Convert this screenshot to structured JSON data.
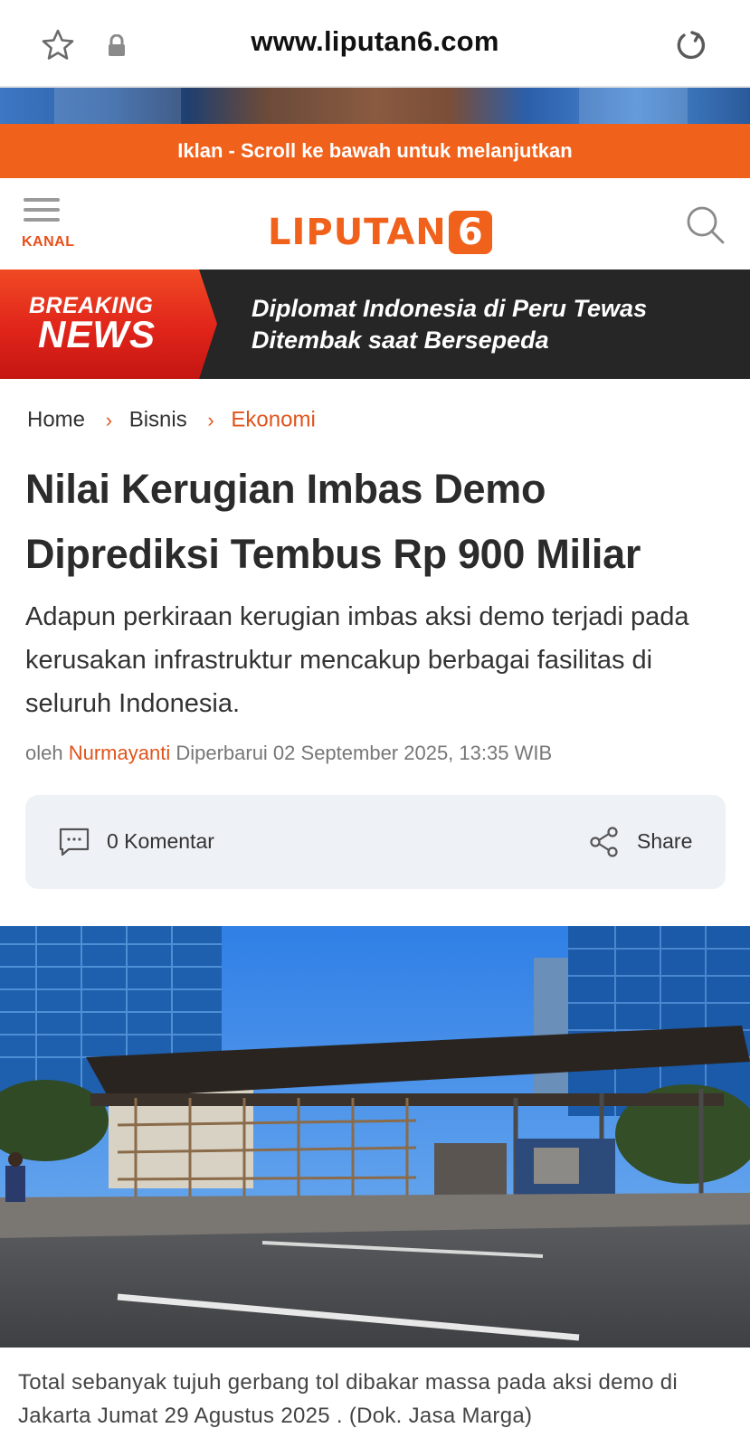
{
  "browser": {
    "url": "www.liputan6.com",
    "icons": [
      "star-icon",
      "lock-icon",
      "reload-icon"
    ]
  },
  "ad": {
    "banner_text": "Iklan - Scroll ke bawah untuk melanjutkan"
  },
  "header": {
    "menu_label": "KANAL",
    "logo_text": "LIPUTAN",
    "logo_number": "6",
    "accent_color": "#f0611c"
  },
  "breaking": {
    "badge_top": "BREAKING",
    "badge_bottom": "NEWS",
    "headline": "Diplomat Indonesia di Peru Tewas Ditembak saat Bersepeda"
  },
  "breadcrumb": {
    "items": [
      "Home",
      "Bisnis",
      "Ekonomi"
    ]
  },
  "article": {
    "title": "Nilai Kerugian Imbas Demo Diprediksi Tembus Rp 900 Miliar",
    "summary": "Adapun perkiraan kerugian imbas aksi demo terjadi pada kerusakan infrastruktur mencakup berbagai fasilitas di seluruh Indonesia.",
    "byline_prefix": "oleh",
    "author": "Nurmayanti",
    "updated": "Diperbarui 02 September 2025, 13:35 WIB",
    "comments_label": "0 Komentar",
    "share_label": "Share",
    "caption": "Total sebanyak tujuh gerbang tol dibakar massa pada aksi demo di Jakarta Jumat 29 Agustus 2025 . (Dok. Jasa Marga)"
  }
}
